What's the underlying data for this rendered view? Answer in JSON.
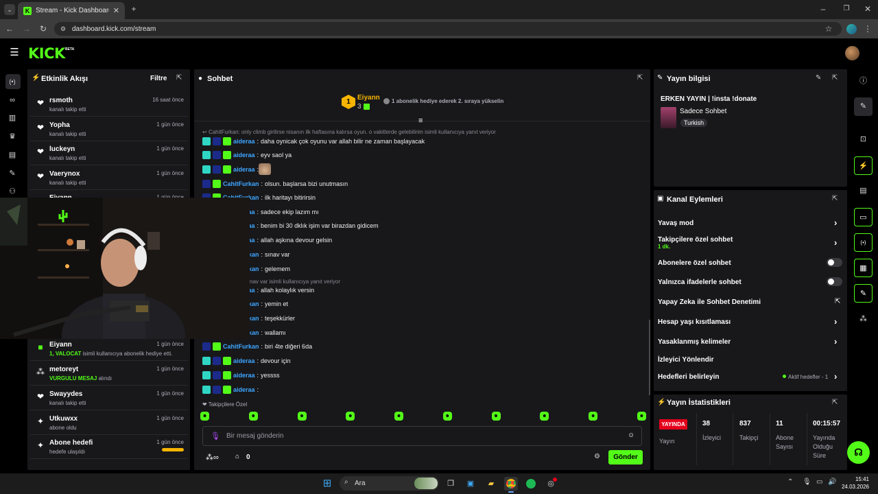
{
  "browser": {
    "tab_title": "Stream - Kick Dashboard",
    "url": "dashboard.kick.com/stream"
  },
  "header": {
    "logo": "KICK",
    "badge": "BETA"
  },
  "activity": {
    "title": "Etkinlik Akışı",
    "filter_label": "Filtre",
    "items": [
      {
        "icon": "heart-icon",
        "name": "rsmoth",
        "sub": "kanalı takip etti",
        "time": "16 saat önce"
      },
      {
        "icon": "heart-icon",
        "name": "Yopha",
        "sub": "kanalı takip etti",
        "time": "1 gün önce"
      },
      {
        "icon": "heart-icon",
        "name": "luckeyn",
        "sub": "kanalı takip etti",
        "time": "1 gün önce"
      },
      {
        "icon": "heart-icon",
        "name": "Vaerynox",
        "sub": "kanalı takip etti",
        "time": "1 gün önce"
      },
      {
        "icon": "gift-icon",
        "name": "Eiyann",
        "sub": "",
        "time": "1 gün önce"
      },
      {
        "icon": "gift-icon",
        "name": "Eiyann",
        "sub_green": "1, VALOCAT",
        "sub": " isimli kullanıcıya abonelik hediye etti.",
        "time": "1 gün önce"
      },
      {
        "icon": "dots-icon",
        "name": "metoreyt",
        "sub_green": "VURGULU MESAJ",
        "sub": " alındı",
        "time": "1 gün önce"
      },
      {
        "icon": "heart-icon",
        "name": "Swayydes",
        "sub": "kanalı takip etti",
        "time": "1 gün önce"
      },
      {
        "icon": "sparkle-icon",
        "name": "Utkuwxx",
        "sub": "abone oldu",
        "time": "1 gün önce"
      },
      {
        "icon": "sparkle-icon",
        "name": "Abone hedefi",
        "sub": "hedefe ulaşıldı",
        "time": "1 gün önce",
        "goal_progress": 1.0
      }
    ]
  },
  "chat": {
    "title": "Sohbet",
    "leader_name": "Eiyann",
    "leader_rank": "1",
    "leader_count": "3",
    "leader_cta": "1 abonelik hediye ederek 2. sıraya yükselin",
    "reply_context": "CahitFurkan: only climb girilirse nisanın ilk haftasına kalırsa oyun. o vakitlerde gelebilirim isimli kullanıcıya yanıt veriyor",
    "reply_context_2": "nav var isimli kullanıcıya yanıt veriyor",
    "messages": [
      {
        "user": "aideraa",
        "color": "#3ea6ff",
        "text": "daha oynicak çok oyunu var allah bilir ne zaman başlayacak"
      },
      {
        "user": "aideraa",
        "color": "#3ea6ff",
        "text": "eyv saol ya"
      },
      {
        "user": "aideraa",
        "color": "#3ea6ff",
        "text": ""
      },
      {
        "user": "CahitFurkan",
        "color": "#3ea6ff",
        "text": "olsun. başlarsa bizi unutmasın"
      },
      {
        "user": "CahitFurkan",
        "color": "#3ea6ff",
        "text": "ilk haritayı bitirirsin"
      },
      {
        "user": "aideraa",
        "color": "#3ea6ff",
        "text": "sadece ekip lazım mı"
      },
      {
        "user": "aideraa",
        "color": "#3ea6ff",
        "text": "benim bi 30 dklık işim var birazdan gidicem"
      },
      {
        "user": "aideraa",
        "color": "#3ea6ff",
        "text": "allah aşkına devour gelsin"
      },
      {
        "user": "CahitFurkan",
        "color": "#3ea6ff",
        "text": "sınav var"
      },
      {
        "user": "CahitFurkan",
        "color": "#3ea6ff",
        "text": "gelemem"
      },
      {
        "user": "aideraa",
        "color": "#3ea6ff",
        "text": "allah kolaylık versin"
      },
      {
        "user": "CahitFurkan",
        "color": "#3ea6ff",
        "text": "yemin et"
      },
      {
        "user": "CahitFurkan",
        "color": "#3ea6ff",
        "text": "teşekkürler"
      },
      {
        "user": "CahitFurkan",
        "color": "#3ea6ff",
        "text": "wallamı"
      },
      {
        "user": "CahitFurkan",
        "color": "#3ea6ff",
        "text": "biri 4te diğeri 6da"
      },
      {
        "user": "aideraa",
        "color": "#3ea6ff",
        "text": "devour için"
      },
      {
        "user": "aideraa",
        "color": "#3ea6ff",
        "text": "yessss"
      },
      {
        "user": "aideraa",
        "color": "#3ea6ff",
        "text": ""
      }
    ],
    "followers_only_label": "Takipçilere Özel",
    "input_placeholder": "Bir mesaj gönderin",
    "points_value": "0",
    "send_label": "Gönder"
  },
  "stream_info": {
    "title": "Yayın bilgisi",
    "stream_title": "ERKEN YAYIN | !insta !donate",
    "category": "Sadece Sohbet",
    "tag": "Turkish"
  },
  "channel_actions": {
    "title": "Kanal Eylemleri",
    "slow_mode": "Yavaş mod",
    "followers_only": "Takipçilere özel sohbet",
    "followers_only_duration": "1 dk.",
    "subscribers_only": "Abonelere özel sohbet",
    "emotes_only": "Yalnızca ifadelerle sohbet",
    "ai_moderation": "Yapay Zeka ile Sohbet Denetimi",
    "age_restriction": "Hesap yaşı kısıtlaması",
    "banned_words": "Yasaklanmış kelimeler",
    "viewer_redirect": "İzleyici Yönlendir",
    "set_goals": "Hedefleri belirleyin",
    "active_goals": "Aktif hedefler - 1"
  },
  "stats": {
    "title": "Yayın İstatistikleri",
    "live_badge": "YAYINDA",
    "live_label": "Yayın",
    "viewers_value": "38",
    "viewers_label": "İzleyici",
    "followers_value": "837",
    "followers_label": "Takipçi",
    "subs_value": "11",
    "subs_label": "Abone Sayısı",
    "duration_value": "00:15:57",
    "duration_label": "Yayında Olduğu Süre"
  },
  "taskbar": {
    "search_label": "Ara",
    "time": "15:41",
    "date": "24.03.2026"
  },
  "colors": {
    "accent": "#53fc18",
    "panel": "#18181b",
    "live": "#e4001b"
  }
}
